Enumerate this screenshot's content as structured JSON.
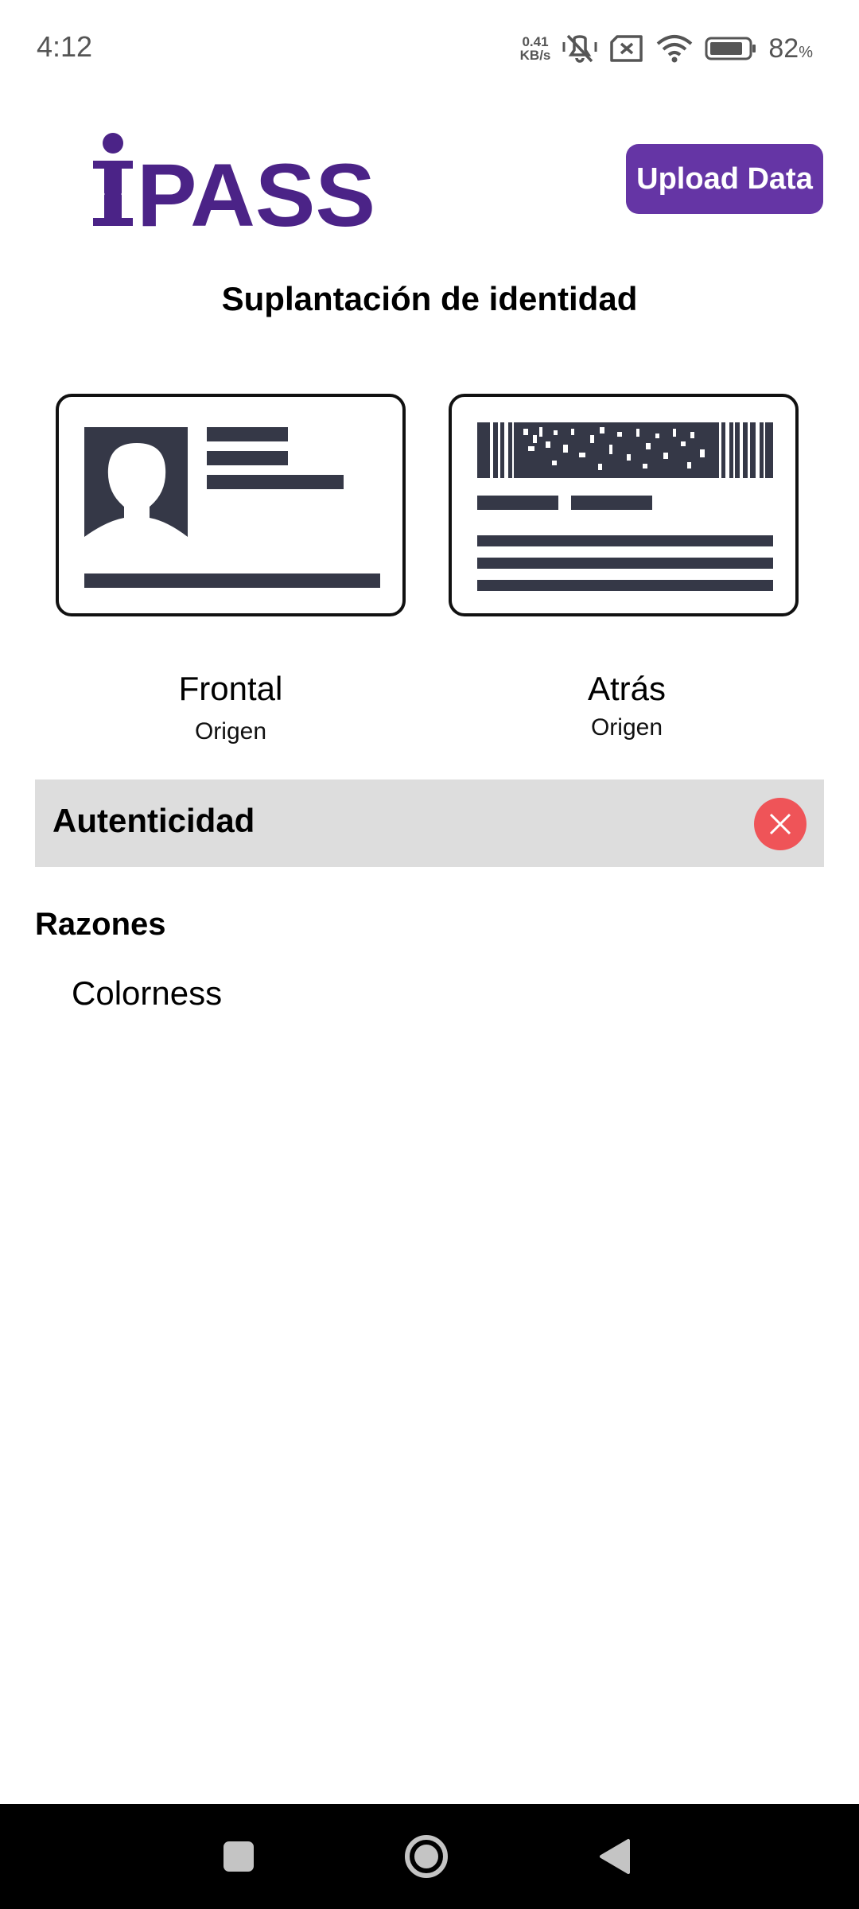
{
  "status_bar": {
    "time": "4:12",
    "net_speed_value": "0.41",
    "net_speed_unit": "KB/s",
    "battery_percent": "82",
    "battery_percent_sign": "%"
  },
  "header": {
    "logo_text": "IPASS",
    "upload_button_label": "Upload Data"
  },
  "page": {
    "title": "Suplantación de identidad"
  },
  "documents": [
    {
      "label": "Frontal",
      "sublabel": "Origen"
    },
    {
      "label": "Atrás",
      "sublabel": "Origen"
    }
  ],
  "authenticity": {
    "label": "Autenticidad",
    "status_icon": "close-icon"
  },
  "reasons": {
    "title": "Razones",
    "items": [
      "Colorness"
    ]
  },
  "colors": {
    "brand_purple": "#6535a5",
    "logo_purple": "#4b2387",
    "error_red": "#ef5458",
    "bar_gray": "#dddddd"
  },
  "nav_bar": {
    "icons": [
      "recents-icon",
      "home-icon",
      "back-icon"
    ]
  }
}
